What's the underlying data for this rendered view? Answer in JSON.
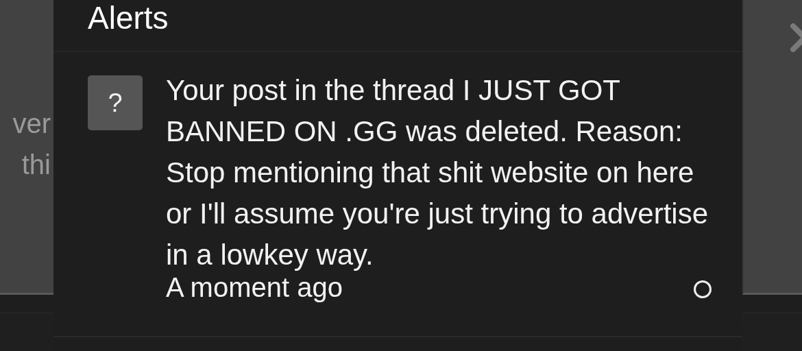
{
  "background": {
    "text_lines": [
      "ver",
      "thi"
    ]
  },
  "panel": {
    "title": "Alerts",
    "alerts": [
      {
        "icon": "?",
        "message": "Your post in the thread I JUST GOT BANNED ON .GG was deleted. Reason: Stop mentioning that shit website on here or I'll assume you're just trying to advertise in a lowkey way.",
        "time": "A moment ago",
        "read": false
      }
    ]
  }
}
